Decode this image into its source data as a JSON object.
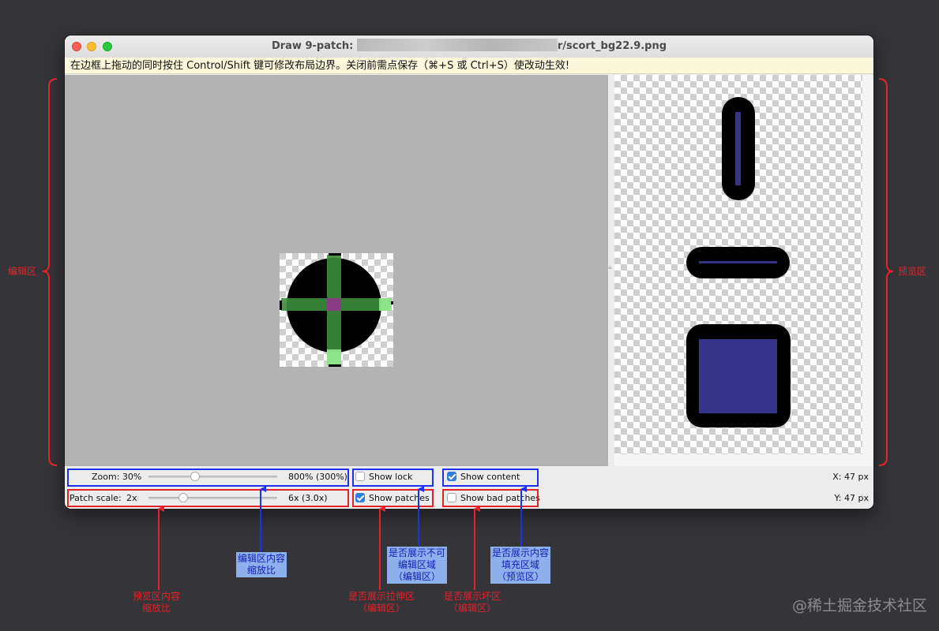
{
  "window": {
    "title_prefix": "Draw 9-patch: ",
    "title_suffix": "r/scort_bg22.9.png",
    "hint": "在边框上拖动的同时按住 Control/Shift 键可修改布局边界。关闭前需点保存（⌘+S 或 Ctrl+S）使改动生效!"
  },
  "controls": {
    "zoom_label": "Zoom: 30%",
    "zoom_max": "800% (300%)",
    "zoom_value_fraction": 0.35,
    "patch_scale_label": "Patch scale:",
    "patch_scale_min": "2x",
    "patch_scale_max": "6x (3.0x)",
    "patch_scale_value_fraction": 0.25,
    "show_lock": {
      "label": "Show lock",
      "checked": false
    },
    "show_patches": {
      "label": "Show patches",
      "checked": true
    },
    "show_content": {
      "label": "Show content",
      "checked": true
    },
    "show_bad_patches": {
      "label": "Show bad patches",
      "checked": false
    },
    "x_readout": "X: 47 px",
    "y_readout": "Y: 47 px"
  },
  "annotations": {
    "editor_area": "编辑区",
    "preview_area": "预览区",
    "zoom_note": "编辑区内容\n缩放比",
    "patch_scale_note": "预览区内容\n缩放比",
    "show_patches_note": "是否展示拉伸区\n（编辑区）",
    "show_lock_note": "是否展示不可\n编辑区域\n（编辑区）",
    "show_bad_patches_note": "是否展示坏区\n（编辑区）",
    "show_content_note": "是否展示内容\n填充区域\n（预览区）"
  },
  "watermark": "@稀土掘金技术社区",
  "colors": {
    "blue_annotation": "#1f2ff0",
    "red_annotation": "#e5212a",
    "patch_green": "#3c8e3c",
    "content_fill": "#35348a"
  }
}
